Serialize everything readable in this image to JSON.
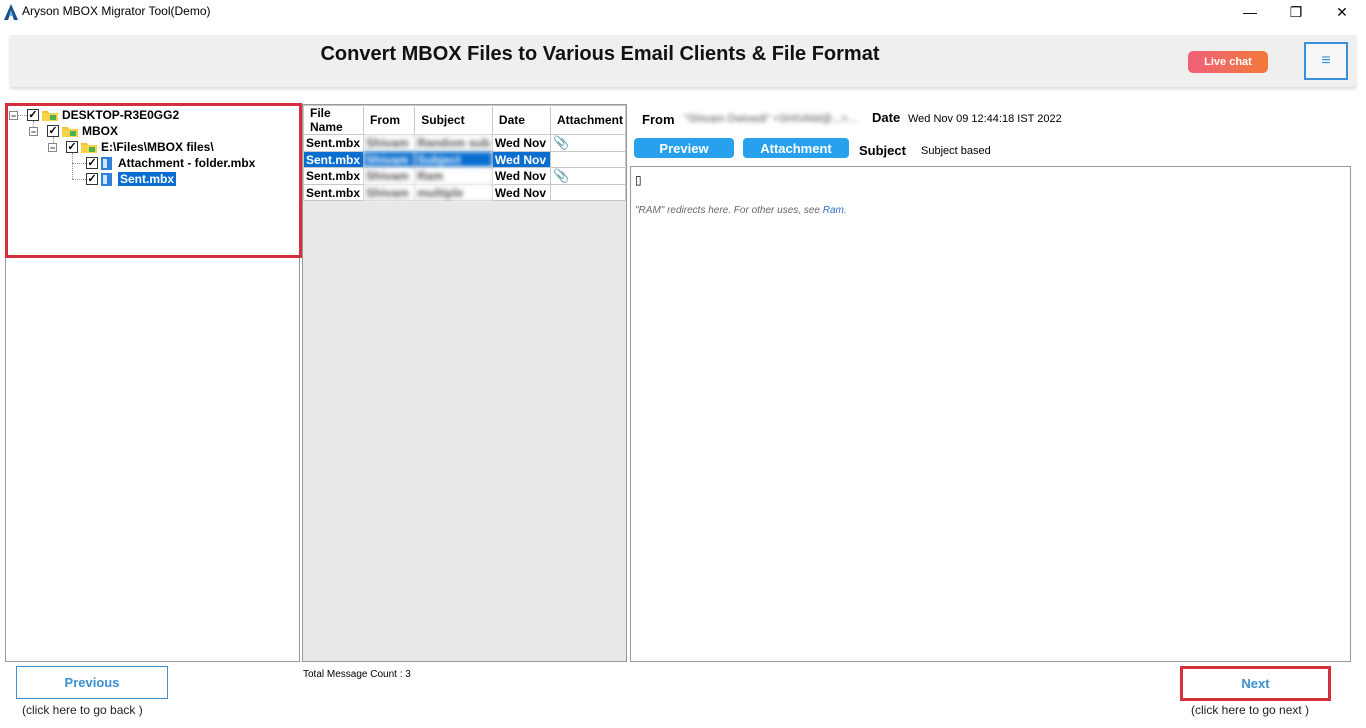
{
  "window": {
    "title": "Aryson MBOX Migrator Tool(Demo)",
    "minimize_glyph": "—",
    "restore_glyph": "❐",
    "close_glyph": "✕"
  },
  "banner": {
    "title": "Convert MBOX Files to Various Email Clients & File Format",
    "live_chat_label": "Live chat",
    "menu_glyph": "≡"
  },
  "tree": {
    "root": {
      "label": "DESKTOP-R3E0GG2",
      "expander": "−",
      "check": "✓"
    },
    "mbox": {
      "label": "MBOX",
      "expander": "−",
      "check": "✓"
    },
    "folder": {
      "label": "E:\\Files\\MBOX files\\",
      "expander": "−",
      "check": "✓"
    },
    "files": [
      {
        "label": "Attachment - folder.mbx",
        "check": "✓",
        "selected": false
      },
      {
        "label": "Sent.mbx",
        "check": "✓",
        "selected": true
      }
    ]
  },
  "message_list": {
    "columns": [
      "File Name",
      "From",
      "Subject",
      "Date",
      "Attachment"
    ],
    "rows": [
      {
        "file": "Sent.mbx",
        "from": "Shivam",
        "subject": "Random sub",
        "date": "Wed Nov",
        "attachment": true
      },
      {
        "file": "Sent.mbx",
        "from": "Shivam",
        "subject": "Subject",
        "date": "Wed Nov",
        "attachment": false
      },
      {
        "file": "Sent.mbx",
        "from": "Shivam",
        "subject": "Ram",
        "date": "Wed Nov",
        "attachment": true
      },
      {
        "file": "Sent.mbx",
        "from": "Shivam",
        "subject": "multiple",
        "date": "Wed Nov",
        "attachment": false
      }
    ],
    "attachment_glyph": "📎",
    "selected_row_index": 1,
    "total_count_text": "Total Message Count : 3"
  },
  "detail": {
    "from_label": "From",
    "from_value": "\"Shivam Dwivedi\" <SHIVAM@...>...",
    "date_label": "Date",
    "date_value": "Wed Nov 09 12:44:18 IST 2022",
    "preview_button": "Preview",
    "attachment_button": "Attachment",
    "subject_label": "Subject",
    "subject_value": "Subject based",
    "body_glyph": "▯",
    "body_text": "\"RAM\" redirects here. For other uses, see ",
    "body_link": "Ram."
  },
  "footer": {
    "previous_label": "Previous",
    "previous_hint": "(click here to  go back )",
    "next_label": "Next",
    "next_hint": "(click here to  go next )"
  },
  "colors": {
    "accent": "#3a8fd6",
    "selection": "#0a6ed1",
    "highlight_border": "#d32f3c",
    "pill_button": "#27a0ee"
  }
}
